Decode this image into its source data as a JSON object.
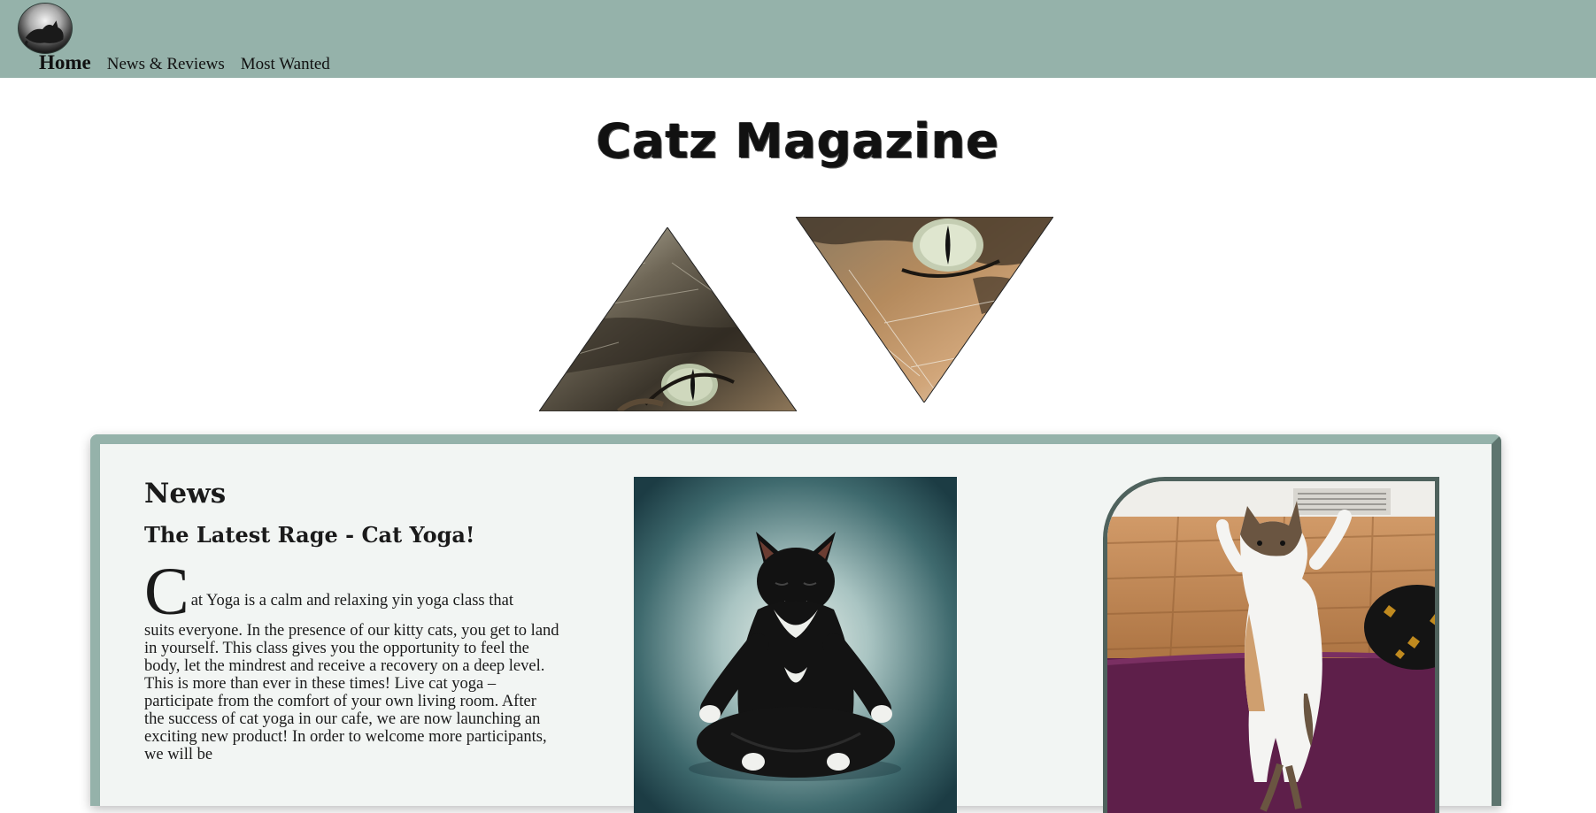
{
  "nav": {
    "logo_icon": "cat-logo-icon",
    "items": [
      {
        "label": "Home",
        "active": true
      },
      {
        "label": "News & Reviews",
        "active": false
      },
      {
        "label": "Most Wanted",
        "active": false
      }
    ]
  },
  "hero": {
    "title": "Catz Magazine",
    "images": [
      "cat-eye-triangle-up",
      "cat-eye-triangle-down"
    ]
  },
  "news": {
    "heading": "News",
    "article_title": "The Latest Rage - Cat Yoga!",
    "dropcap": "C",
    "first_line": "at Yoga is a calm and relaxing yin yoga class that",
    "body": "suits everyone. In the presence of our kitty cats, you get to land in yourself. This class gives you the opportunity to feel the body, let the mindrest and receive a recovery on a deep level. This is more than ever in these times! Live cat yoga – participate from the comfort of your own living room. After the success of cat yoga in our cafe, we are now launching an exciting new product! In order to welcome more participants, we will be",
    "images": [
      "meditating-cat-photo",
      "standing-cat-video"
    ]
  },
  "colors": {
    "topbar": "#95b2aa",
    "card_bg": "#f2f5f3",
    "card_border_dark": "#5e756f"
  }
}
